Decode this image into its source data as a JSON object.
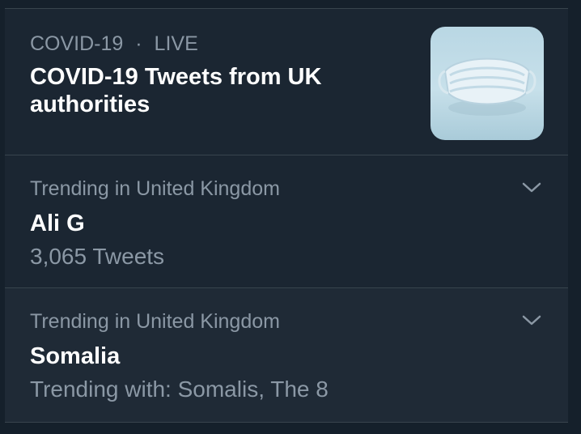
{
  "header": {
    "topic_label": "COVID-19",
    "separator": "·",
    "status_label": "LIVE",
    "headline": "COVID-19 Tweets from UK authorities",
    "thumbnail_icon": "medical-mask-icon"
  },
  "trends": [
    {
      "context": "Trending in United Kingdom",
      "title": "Ali G",
      "detail": "3,065 Tweets",
      "menu_icon": "chevron-down-icon"
    },
    {
      "context": "Trending in United Kingdom",
      "title": "Somalia",
      "detail": "Trending with: Somalis, The 8",
      "menu_icon": "chevron-down-icon"
    }
  ],
  "colors": {
    "background": "#15202b",
    "card": "#1b2632",
    "hover_card": "#1f2a36",
    "muted_text": "#8b98a5",
    "primary_text": "#ffffff",
    "divider": "#38444d"
  }
}
